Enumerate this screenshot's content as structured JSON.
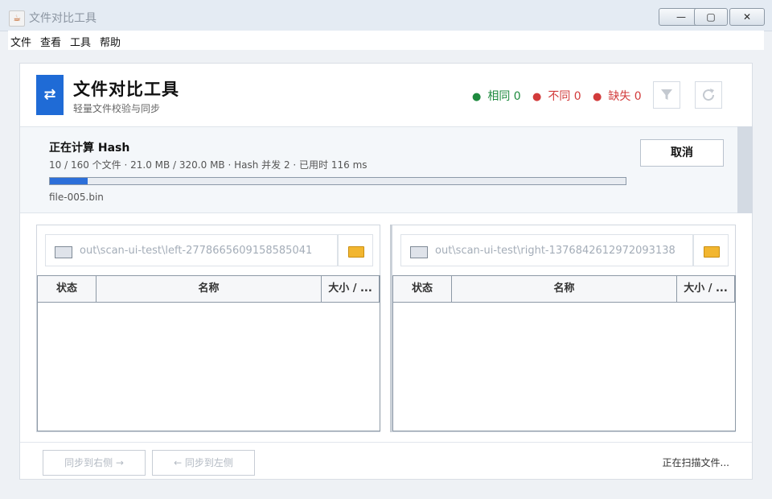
{
  "window": {
    "title": "文件对比工具",
    "minimize": "—",
    "maximize": "▢",
    "close": "✕"
  },
  "menu": [
    "文件",
    "查看",
    "工具",
    "帮助"
  ],
  "header": {
    "title": "文件对比工具",
    "subtitle": "轻量文件校验与同步",
    "logo_glyph": "⇄"
  },
  "stats": [
    {
      "label": "相同",
      "value": "0",
      "color": "#1e8a3e"
    },
    {
      "label": "不同",
      "value": "0",
      "color": "#d23b3b"
    },
    {
      "label": "缺失",
      "value": "0",
      "color": "#d23b3b"
    }
  ],
  "icons": {
    "filter": "filter-icon",
    "refresh": "refresh-icon"
  },
  "progress": {
    "title": "正在计算 Hash",
    "detail": "10 / 160 个文件 · 21.0 MB / 320.0 MB · Hash 并发 2 · 已用时 116 ms",
    "percent": 6.6,
    "current_file": "file-005.bin",
    "cancel_label": "取消"
  },
  "left": {
    "path": "out\\scan-ui-test\\left-2778665609158585041",
    "columns": [
      "状态",
      "名称",
      "大小 / ..."
    ]
  },
  "right": {
    "path": "out\\scan-ui-test\\right-1376842612972093138",
    "columns": [
      "状态",
      "名称",
      "大小 / ..."
    ]
  },
  "footer": {
    "sync_right": "同步到右侧 →",
    "sync_left": "← 同步到左侧",
    "status": "正在扫描文件..."
  },
  "colors": {
    "accent": "#1f6bd6",
    "ok": "#1e8a3e",
    "bad": "#d23b3b"
  }
}
